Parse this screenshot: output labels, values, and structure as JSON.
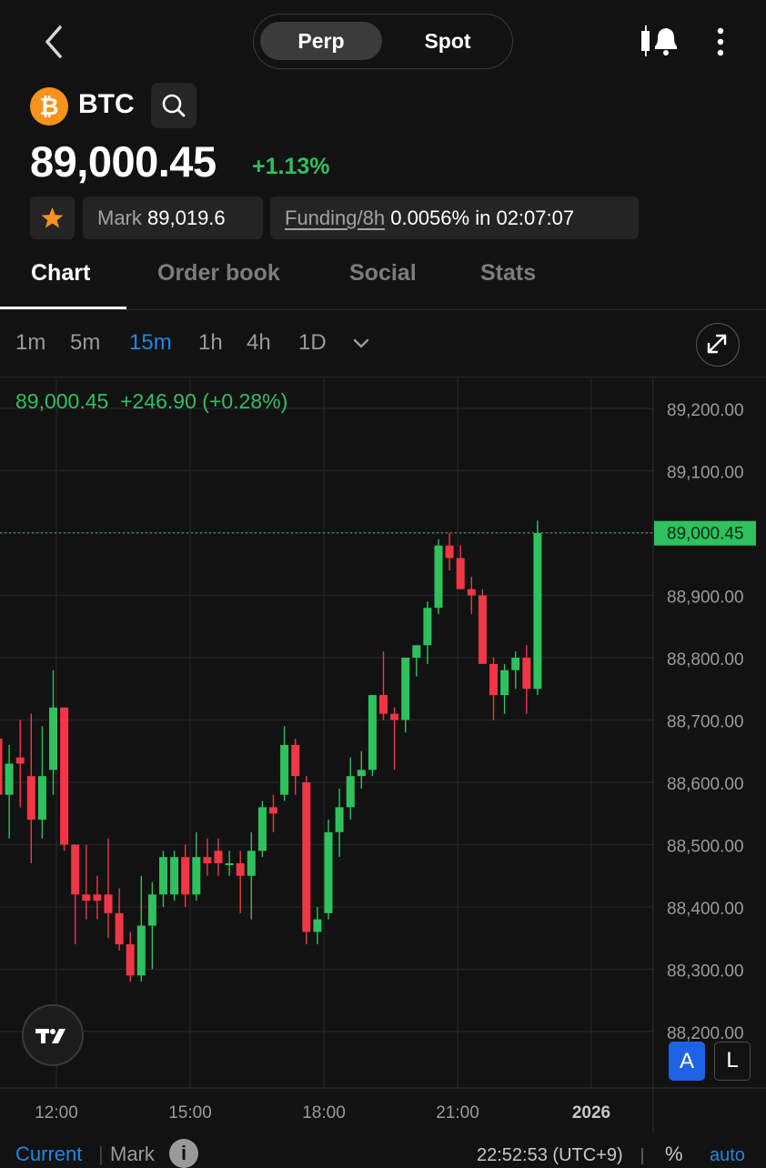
{
  "header": {
    "market_tabs": [
      "Perp",
      "Spot"
    ],
    "active_market_tab": "Perp"
  },
  "ticker": {
    "symbol": "BTC",
    "coin_glyph": "₿",
    "price": "89,000.45",
    "change_pct": "+1.13%",
    "mark_label": "Mark",
    "mark_value": "89,019.6",
    "funding_label": "Funding/8h",
    "funding_rate": "0.0056%",
    "funding_in": "in",
    "funding_countdown": "02:07:07"
  },
  "tabs": [
    "Chart",
    "Order book",
    "Social",
    "Stats"
  ],
  "active_tab": "Chart",
  "timeframes": [
    "1m",
    "5m",
    "15m",
    "1h",
    "4h",
    "1D"
  ],
  "active_timeframe": "15m",
  "chart_legend": {
    "close": "89,000.45",
    "change": "+246.90 (+0.28%)"
  },
  "chart_controls": {
    "a_label": "A",
    "l_label": "L"
  },
  "footer": {
    "current_label": "Current",
    "mark_label": "Mark",
    "time": "22:52:53 (UTC+9)",
    "percent": "%",
    "auto": "auto"
  },
  "colors": {
    "up": "#2ec15e",
    "down": "#f23645",
    "accent": "#1e88e5",
    "bitcoin": "#f7931a"
  },
  "chart_data": {
    "type": "candlestick",
    "interval": "15m",
    "y_ticks": [
      "89,200.00",
      "89,100.00",
      "89,000.00",
      "88,900.00",
      "88,800.00",
      "88,700.00",
      "88,600.00",
      "88,500.00",
      "88,400.00",
      "88,300.00",
      "88,200.00"
    ],
    "x_ticks": [
      "12:00",
      "15:00",
      "18:00",
      "21:00",
      "2026"
    ],
    "last_price_label": "89,000.45",
    "last_price": 89000.45,
    "ylim": [
      88150,
      89250
    ],
    "candles": [
      {
        "t": "11:00",
        "o": 88670,
        "h": 88780,
        "l": 88600,
        "c": 88580
      },
      {
        "t": "11:15",
        "o": 88580,
        "h": 88660,
        "l": 88510,
        "c": 88630
      },
      {
        "t": "11:30",
        "o": 88640,
        "h": 88700,
        "l": 88560,
        "c": 88630
      },
      {
        "t": "11:45",
        "o": 88610,
        "h": 88710,
        "l": 88470,
        "c": 88540
      },
      {
        "t": "12:00",
        "o": 88540,
        "h": 88690,
        "l": 88510,
        "c": 88610
      },
      {
        "t": "12:15",
        "o": 88620,
        "h": 88780,
        "l": 88580,
        "c": 88720
      },
      {
        "t": "12:30",
        "o": 88720,
        "h": 88720,
        "l": 88490,
        "c": 88500
      },
      {
        "t": "12:45",
        "o": 88500,
        "h": 88490,
        "l": 88340,
        "c": 88420
      },
      {
        "t": "13:00",
        "o": 88420,
        "h": 88500,
        "l": 88380,
        "c": 88410
      },
      {
        "t": "13:15",
        "o": 88420,
        "h": 88450,
        "l": 88380,
        "c": 88410
      },
      {
        "t": "13:30",
        "o": 88420,
        "h": 88510,
        "l": 88350,
        "c": 88390
      },
      {
        "t": "13:45",
        "o": 88390,
        "h": 88430,
        "l": 88330,
        "c": 88340
      },
      {
        "t": "14:00",
        "o": 88340,
        "h": 88360,
        "l": 88280,
        "c": 88290
      },
      {
        "t": "14:15",
        "o": 88290,
        "h": 88450,
        "l": 88280,
        "c": 88370
      },
      {
        "t": "14:30",
        "o": 88370,
        "h": 88440,
        "l": 88300,
        "c": 88420
      },
      {
        "t": "14:45",
        "o": 88420,
        "h": 88490,
        "l": 88400,
        "c": 88480
      },
      {
        "t": "15:00",
        "o": 88420,
        "h": 88490,
        "l": 88410,
        "c": 88480
      },
      {
        "t": "15:15",
        "o": 88480,
        "h": 88500,
        "l": 88400,
        "c": 88420
      },
      {
        "t": "15:30",
        "o": 88420,
        "h": 88520,
        "l": 88410,
        "c": 88480
      },
      {
        "t": "15:45",
        "o": 88480,
        "h": 88510,
        "l": 88450,
        "c": 88470
      },
      {
        "t": "16:00",
        "o": 88490,
        "h": 88510,
        "l": 88450,
        "c": 88470
      },
      {
        "t": "16:15",
        "o": 88470,
        "h": 88490,
        "l": 88450,
        "c": 88470
      },
      {
        "t": "16:30",
        "o": 88470,
        "h": 88490,
        "l": 88390,
        "c": 88450
      },
      {
        "t": "16:45",
        "o": 88450,
        "h": 88520,
        "l": 88380,
        "c": 88490
      },
      {
        "t": "17:00",
        "o": 88490,
        "h": 88570,
        "l": 88480,
        "c": 88560
      },
      {
        "t": "17:15",
        "o": 88560,
        "h": 88580,
        "l": 88520,
        "c": 88550
      },
      {
        "t": "17:30",
        "o": 88580,
        "h": 88690,
        "l": 88570,
        "c": 88660
      },
      {
        "t": "17:45",
        "o": 88660,
        "h": 88670,
        "l": 88580,
        "c": 88610
      },
      {
        "t": "18:00",
        "o": 88600,
        "h": 88610,
        "l": 88340,
        "c": 88360
      },
      {
        "t": "18:15",
        "o": 88360,
        "h": 88400,
        "l": 88340,
        "c": 88380
      },
      {
        "t": "18:30",
        "o": 88390,
        "h": 88540,
        "l": 88380,
        "c": 88520
      },
      {
        "t": "18:45",
        "o": 88520,
        "h": 88590,
        "l": 88480,
        "c": 88560
      },
      {
        "t": "19:00",
        "o": 88560,
        "h": 88640,
        "l": 88540,
        "c": 88610
      },
      {
        "t": "19:15",
        "o": 88610,
        "h": 88650,
        "l": 88590,
        "c": 88620
      },
      {
        "t": "19:30",
        "o": 88620,
        "h": 88730,
        "l": 88610,
        "c": 88740
      },
      {
        "t": "19:45",
        "o": 88740,
        "h": 88810,
        "l": 88700,
        "c": 88710
      },
      {
        "t": "20:00",
        "o": 88710,
        "h": 88720,
        "l": 88620,
        "c": 88700
      },
      {
        "t": "20:15",
        "o": 88700,
        "h": 88780,
        "l": 88680,
        "c": 88800
      },
      {
        "t": "20:30",
        "o": 88800,
        "h": 88820,
        "l": 88770,
        "c": 88820
      },
      {
        "t": "20:45",
        "o": 88820,
        "h": 88890,
        "l": 88790,
        "c": 88880
      },
      {
        "t": "21:00",
        "o": 88880,
        "h": 88990,
        "l": 88870,
        "c": 88980
      },
      {
        "t": "21:15",
        "o": 88980,
        "h": 89000,
        "l": 88940,
        "c": 88960
      },
      {
        "t": "21:30",
        "o": 88960,
        "h": 88980,
        "l": 88920,
        "c": 88910
      },
      {
        "t": "21:45",
        "o": 88910,
        "h": 88930,
        "l": 88870,
        "c": 88900
      },
      {
        "t": "22:00",
        "o": 88900,
        "h": 88910,
        "l": 88810,
        "c": 88790
      },
      {
        "t": "22:15",
        "o": 88790,
        "h": 88800,
        "l": 88700,
        "c": 88740
      },
      {
        "t": "22:30",
        "o": 88740,
        "h": 88790,
        "l": 88710,
        "c": 88780
      },
      {
        "t": "22:45",
        "o": 88780,
        "h": 88810,
        "l": 88750,
        "c": 88800
      },
      {
        "t": "23:00",
        "o": 88800,
        "h": 88820,
        "l": 88710,
        "c": 88750
      },
      {
        "t": "23:15",
        "o": 88750,
        "h": 89020,
        "l": 88740,
        "c": 89000
      }
    ]
  }
}
